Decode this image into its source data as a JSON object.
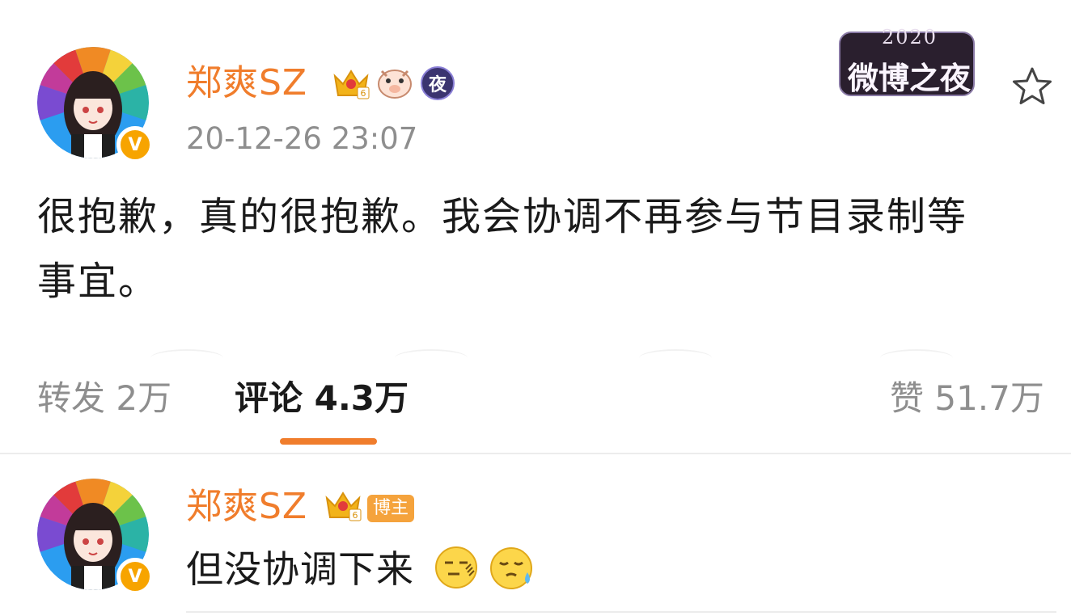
{
  "post": {
    "username": "郑爽SZ",
    "timestamp": "20-12-26 23:07",
    "night_badge_label": "夜",
    "event_badge": {
      "year": "2020",
      "title": "微博之夜"
    },
    "text_line1": "很抱歉，真的很抱歉。我会协调不再参与节目录制等",
    "text_line2": "事宜。",
    "favorite_icon": "star-outline-icon"
  },
  "tabs": {
    "repost": "转发 2万",
    "comments": "评论 4.3万",
    "likes": "赞 51.7万"
  },
  "comment": {
    "username": "郑爽SZ",
    "author_tag": "博主",
    "text": "但没协调下来",
    "emojis": [
      "speechless-emoji",
      "sweat-emoji"
    ]
  },
  "colors": {
    "accent": "#f07d2c",
    "muted": "#8e8e8e",
    "verified": "#f7a400",
    "crown": "#f2b31a"
  }
}
